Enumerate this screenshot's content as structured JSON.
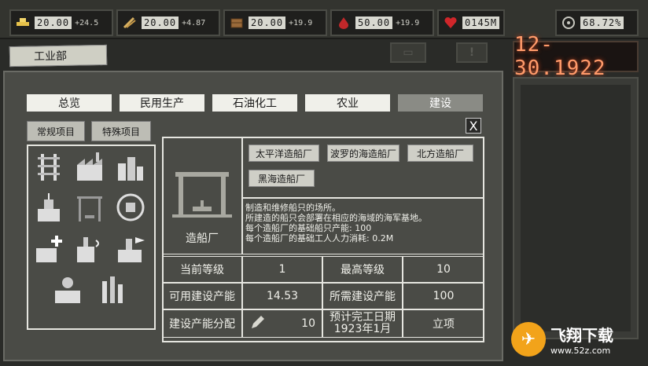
{
  "resources": [
    {
      "icon": "gold-bars-icon",
      "value": "20.00",
      "rate": "+24.5"
    },
    {
      "icon": "wheat-icon",
      "value": "20.00",
      "rate": "+4.87"
    },
    {
      "icon": "crate-icon",
      "value": "20.00",
      "rate": "+19.9"
    },
    {
      "icon": "oil-drop-icon",
      "value": "50.00",
      "rate": "+19.9"
    },
    {
      "icon": "heart-icon",
      "value": "0145M",
      "rate": ""
    },
    {
      "icon": "stability-icon",
      "value": "68.72%",
      "rate": ""
    }
  ],
  "banner": {
    "title": "工业部"
  },
  "date": "12-30.1922",
  "tabs": [
    {
      "label": "总览"
    },
    {
      "label": "民用生产"
    },
    {
      "label": "石油化工"
    },
    {
      "label": "农业"
    },
    {
      "label": "建设"
    }
  ],
  "subtabs": {
    "regular": "常规项目",
    "special": "特殊项目"
  },
  "close_label": "X",
  "building": {
    "name": "造船厂"
  },
  "shipyards": [
    "太平洋造船厂",
    "波罗的海造船厂",
    "北方造船厂",
    "黑海造船厂"
  ],
  "description": [
    "制造和维修船只的场所。",
    "所建造的船只会部署在相应的海域的海军基地。",
    "每个造船厂的基础船只产能: 100",
    "每个造船厂的基础工人人力消耗: 0.2M"
  ],
  "stats": {
    "current_level_label": "当前等级",
    "current_level": "1",
    "max_level_label": "最高等级",
    "max_level": "10",
    "available_capacity_label": "可用建设产能",
    "available_capacity": "14.53",
    "required_capacity_label": "所需建设产能",
    "required_capacity": "100",
    "allocation_label": "建设产能分配",
    "allocation": "10",
    "completion_label": "预计完工日期",
    "completion_date": "1923年1月",
    "start_label": "立项"
  },
  "watermark": {
    "brand": "飞翔下载",
    "site": "www.52z.com"
  }
}
